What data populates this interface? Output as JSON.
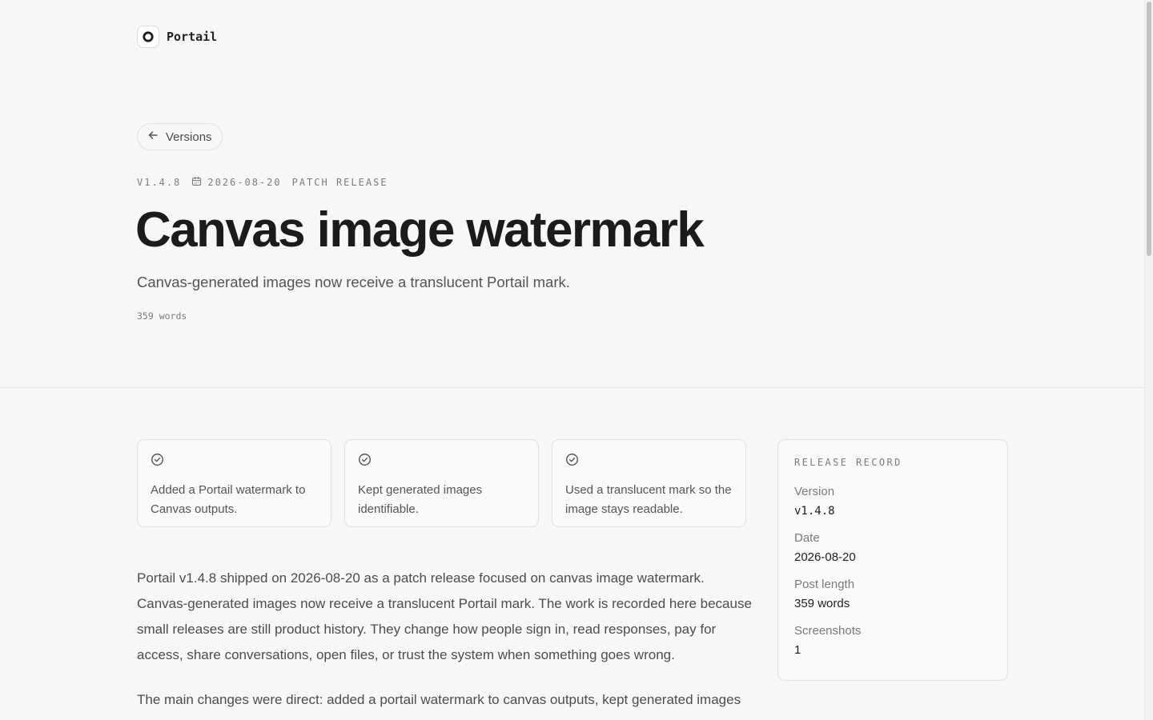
{
  "brand": {
    "name": "Portail"
  },
  "nav": {
    "back_label": "Versions"
  },
  "release": {
    "version": "V1.4.8",
    "date": "2026-08-20",
    "type": "PATCH RELEASE",
    "title": "Canvas image watermark",
    "subtitle": "Canvas-generated images now receive a translucent Portail mark.",
    "word_count": "359 words"
  },
  "highlights": [
    {
      "icon": "check-circle-icon",
      "text": "Added a Portail watermark to Canvas outputs."
    },
    {
      "icon": "check-circle-icon",
      "text": "Kept generated images identifiable."
    },
    {
      "icon": "check-circle-icon",
      "text": "Used a translucent mark so the image stays readable."
    }
  ],
  "body": {
    "paragraphs": [
      "Portail v1.4.8 shipped on 2026-08-20 as a patch release focused on canvas image watermark. Canvas-generated images now receive a translucent Portail mark. The work is recorded here because small releases are still product history. They change how people sign in, read responses, pay for access, share conversations, open files, or trust the system when something goes wrong.",
      "The main changes were direct: added a portail watermark to canvas outputs, kept generated images"
    ]
  },
  "record": {
    "heading": "RELEASE RECORD",
    "rows": [
      {
        "label": "Version",
        "value": "v1.4.8"
      },
      {
        "label": "Date",
        "value": "2026-08-20"
      },
      {
        "label": "Post length",
        "value": "359 words"
      },
      {
        "label": "Screenshots",
        "value": "1"
      }
    ]
  },
  "colors": {
    "background": "#f7f7f7",
    "text": "#1b1b1c",
    "muted": "#7c7c7c",
    "border": "#e0e0e0"
  }
}
